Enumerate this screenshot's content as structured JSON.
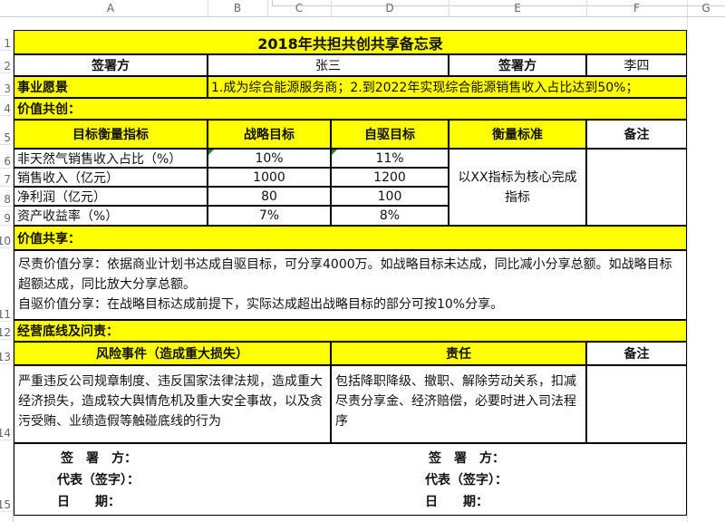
{
  "columns": [
    "A",
    "B",
    "C",
    "D",
    "E",
    "F",
    "G"
  ],
  "rows": [
    "1",
    "2",
    "3",
    "4",
    "5",
    "6",
    "7",
    "8",
    "9",
    "10",
    "11",
    "12",
    "13",
    "14",
    "15"
  ],
  "title": "2018年共担共创共享备忘录",
  "signatory_label": "签署方",
  "party_a": "张三",
  "party_b": "李四",
  "vision_label": "事业愿景",
  "vision_text": "1.成为综合能源服务商；2.到2022年实现综合能源销售收入占比达到50%；",
  "section_value_create": "价值共创：",
  "table1": {
    "headers": [
      "目标衡量指标",
      "战略目标",
      "自驱目标",
      "衡量标准",
      "备注"
    ],
    "rows": [
      {
        "metric": "非天然气销售收入占比（%）",
        "strategic": "10%",
        "self": "11%"
      },
      {
        "metric": "销售收入（亿元）",
        "strategic": "1000",
        "self": "1200"
      },
      {
        "metric": "净利润（亿元）",
        "strategic": "80",
        "self": "100"
      },
      {
        "metric": "资产收益率（%）",
        "strategic": "7%",
        "self": "8%"
      }
    ],
    "standard": "以XX指标为核心完成指标"
  },
  "section_value_share": "价值共享：",
  "share_text_1": "尽责价值分享：依据商业计划书达成自驱目标，可分享4000万。如战略目标未达成，同比减小分享总额。如战略目标超额达成，同比放大分享总额。",
  "share_text_2": "自驱价值分享：在战略目标达成前提下，实际达成超出战略目标的部分可按10%分享。",
  "section_bottom_line": "经营底线及问责：",
  "table2": {
    "headers": [
      "风险事件（造成重大损失）",
      "责任",
      "备注"
    ],
    "risk": "严重违反公司规章制度、违反国家法律法规，造成重大经济损失，造成较大舆情危机及重大安全事故，以及贪污受贿、业绩造假等触碰底线的行为",
    "duty": "包括降职降级、撤职、解除劳动关系，扣减尽责分享金、经济赔偿，必要时进入司法程序"
  },
  "signature": {
    "sign": "签　署　方：",
    "rep": "代表（签字）：",
    "date": "日　　期："
  }
}
